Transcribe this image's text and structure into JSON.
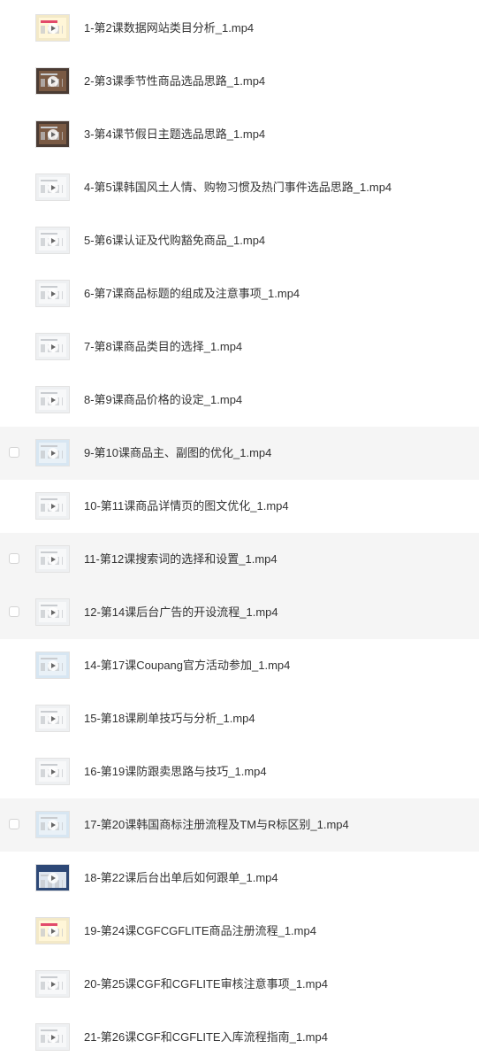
{
  "files": [
    {
      "name": "1-第2课数据网站类目分析_1.mp4",
      "thumb": "promo",
      "selected": false
    },
    {
      "name": "2-第3课季节性商品选品思路_1.mp4",
      "thumb": "dark",
      "selected": false
    },
    {
      "name": "3-第4课节假日主题选品思路_1.mp4",
      "thumb": "dark",
      "selected": false
    },
    {
      "name": "4-第5课韩国风土人情、购物习惯及热门事件选品思路_1.mp4",
      "thumb": "plain",
      "selected": false
    },
    {
      "name": "5-第6课认证及代购豁免商品_1.mp4",
      "thumb": "plain",
      "selected": false
    },
    {
      "name": "6-第7课商品标题的组成及注意事项_1.mp4",
      "thumb": "plain",
      "selected": false
    },
    {
      "name": "7-第8课商品类目的选择_1.mp4",
      "thumb": "plain",
      "selected": false
    },
    {
      "name": "8-第9课商品价格的设定_1.mp4",
      "thumb": "plain",
      "selected": false
    },
    {
      "name": "9-第10课商品主、副图的优化_1.mp4",
      "thumb": "blue",
      "selected": true
    },
    {
      "name": "10-第11课商品详情页的图文优化_1.mp4",
      "thumb": "plain",
      "selected": false
    },
    {
      "name": "11-第12课搜索词的选择和设置_1.mp4",
      "thumb": "plain",
      "selected": true
    },
    {
      "name": "12-第14课后台广告的开设流程_1.mp4",
      "thumb": "plain",
      "selected": true
    },
    {
      "name": "14-第17课Coupang官方活动参加_1.mp4",
      "thumb": "blue",
      "selected": false
    },
    {
      "name": "15-第18课刷单技巧与分析_1.mp4",
      "thumb": "plain",
      "selected": false
    },
    {
      "name": "16-第19课防跟卖思路与技巧_1.mp4",
      "thumb": "plain",
      "selected": false
    },
    {
      "name": "17-第20课韩国商标注册流程及TM与R标区别_1.mp4",
      "thumb": "blue",
      "selected": true
    },
    {
      "name": "18-第22课后台出单后如何跟单_1.mp4",
      "thumb": "navy",
      "selected": false
    },
    {
      "name": "19-第24课CGFCGFLITE商品注册流程_1.mp4",
      "thumb": "promo",
      "selected": false
    },
    {
      "name": "20-第25课CGF和CGFLITE审核注意事项_1.mp4",
      "thumb": "plain",
      "selected": false
    },
    {
      "name": "21-第26课CGF和CGFLITE入库流程指南_1.mp4",
      "thumb": "plain",
      "selected": false
    }
  ],
  "icons": {
    "thumbnail_overlay": "play-icon",
    "row_select": "checkbox-icon"
  },
  "colors": {
    "text": "#333333",
    "row_highlight": "#f5f5f5",
    "checkbox_border": "#d4d4d4"
  }
}
